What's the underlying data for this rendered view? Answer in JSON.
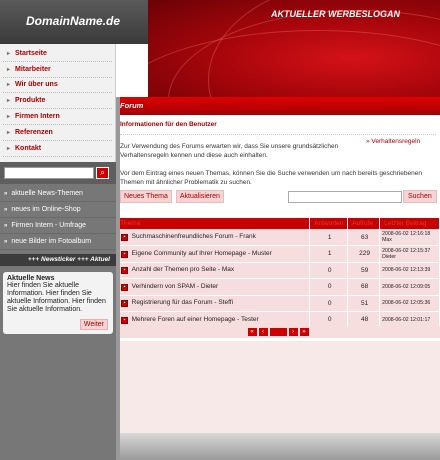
{
  "header": {
    "logo": "DomainName.de",
    "slogan": "AKTUELLER WERBESLOGAN"
  },
  "nav": {
    "items": [
      {
        "label": "Startseite"
      },
      {
        "label": "Mitarbeiter"
      },
      {
        "label": "Wir über uns"
      },
      {
        "label": "Produkte"
      },
      {
        "label": "Firmen Intern"
      },
      {
        "label": "Referenzen"
      },
      {
        "label": "Kontakt"
      }
    ]
  },
  "news_links": [
    {
      "label": "aktuelle News-Themen"
    },
    {
      "label": "neues im Online-Shop"
    },
    {
      "label": "Firmen Intern - Umfrage"
    },
    {
      "label": "neue Bilder im Fotoalbum"
    }
  ],
  "ticker": "+++ Newsticker +++ Aktuel",
  "news_box": {
    "title": "Aktuelle News",
    "body": "Hier finden Sie aktuelle Information. Hier finden Sie aktuelle Information. Hier finden Sie aktuelle Information.",
    "button": "Weiter"
  },
  "forum": {
    "header": "Forum",
    "info_title": "Informationen für den Benutzer",
    "info_text": "Zur Verwendung des Forums erwarten wir, dass Sie unsere grundsätzlichen Verhaltensregeln kennen und diese auch einhalten.",
    "rules_link": "Verhaltensregeln",
    "info_text2": "Vor dem Eintrag eines neuen Themas, können Sie die Suche verwenden um nach bereits geschriebenen Themen mit ähnlicher Problematik zu suchen.",
    "new_topic": "Neues Thema",
    "refresh": "Aktualisieren",
    "search_button": "Suchen",
    "search_placeholder": "",
    "columns": [
      "Thema",
      "Antworten",
      "Aufrufe",
      "Letzter Beitrag"
    ],
    "rows": [
      {
        "title": "Suchmaschinenfreundliches Forum - Frank",
        "replies": "1",
        "views": "63",
        "last": "2008-06-02 12:16:18",
        "user": "Max"
      },
      {
        "title": "Eigene Community auf Ihrer Homepage - Muster",
        "replies": "1",
        "views": "229",
        "last": "2008-06-02 12:15:37",
        "user": "Dieter"
      },
      {
        "title": "Anzahl der Themen pro Seite - Max",
        "replies": "0",
        "views": "59",
        "last": "2008-06-02 12:13:39",
        "user": ""
      },
      {
        "title": "Verhindern von SPAM - Dieter",
        "replies": "0",
        "views": "68",
        "last": "2008-06-02 12:09:05",
        "user": ""
      },
      {
        "title": "Registrierung für das Forum - Steffi",
        "replies": "0",
        "views": "51",
        "last": "2008-06-02 12:05:36",
        "user": ""
      },
      {
        "title": "Mehrere Foren auf einer Homepage - Tester",
        "replies": "0",
        "views": "48",
        "last": "2008-06-02 12:01:17",
        "user": ""
      }
    ]
  }
}
